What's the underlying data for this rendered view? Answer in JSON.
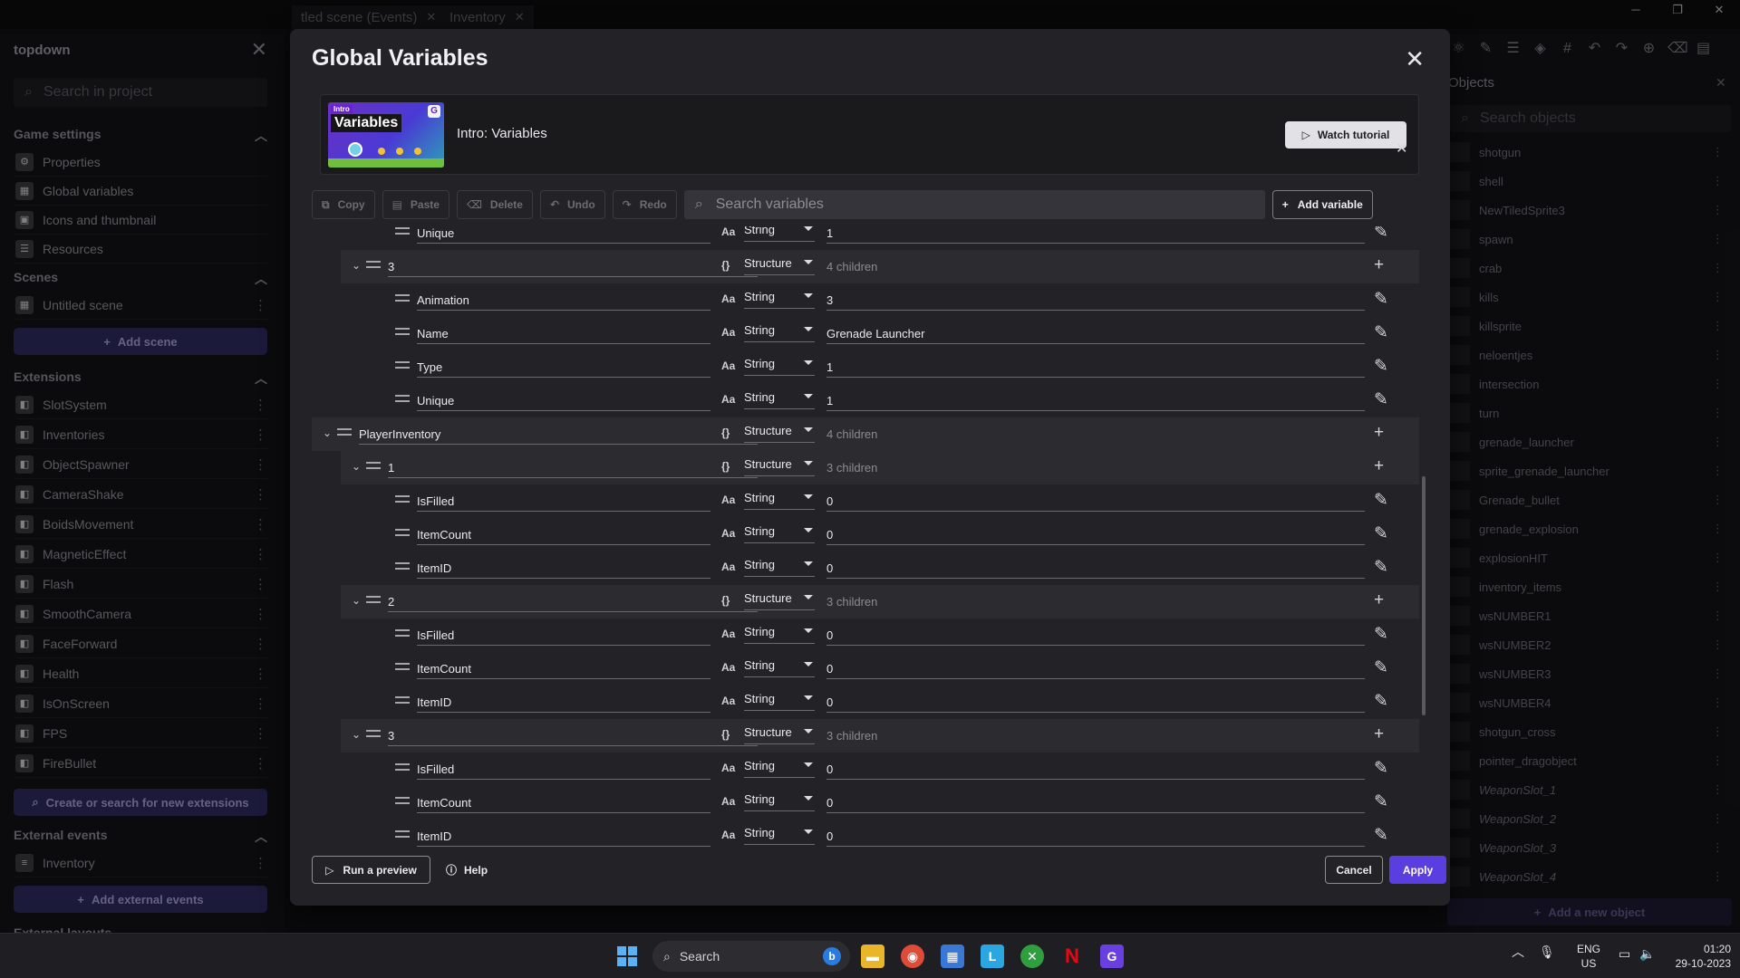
{
  "window": {
    "tabs": [
      {
        "label": "tled scene (Events)"
      },
      {
        "label": "Inventory"
      }
    ],
    "minimize": "─",
    "restore": "❐",
    "close": "✕"
  },
  "sidebar": {
    "project_title": "topdown",
    "search_placeholder": "Search in project",
    "game_settings": {
      "title": "Game settings",
      "items": [
        {
          "label": "Properties",
          "icon": "gear-icon"
        },
        {
          "label": "Global variables",
          "icon": "variables-icon"
        },
        {
          "label": "Icons and thumbnail",
          "icon": "image-icon"
        },
        {
          "label": "Resources",
          "icon": "resources-icon"
        }
      ]
    },
    "scenes": {
      "title": "Scenes",
      "items": [
        {
          "label": "Untitled scene"
        }
      ],
      "add_label": "Add scene"
    },
    "extensions": {
      "title": "Extensions",
      "items": [
        {
          "label": "SlotSystem"
        },
        {
          "label": "Inventories"
        },
        {
          "label": "ObjectSpawner"
        },
        {
          "label": "CameraShake"
        },
        {
          "label": "BoidsMovement"
        },
        {
          "label": "MagneticEffect"
        },
        {
          "label": "Flash"
        },
        {
          "label": "SmoothCamera"
        },
        {
          "label": "FaceForward"
        },
        {
          "label": "Health"
        },
        {
          "label": "IsOnScreen"
        },
        {
          "label": "FPS"
        },
        {
          "label": "FireBullet"
        }
      ],
      "search_label": "Create or search for new extensions"
    },
    "external_events": {
      "title": "External events",
      "items": [
        {
          "label": "Inventory"
        }
      ],
      "add_label": "Add external events"
    },
    "external_layouts_title": "External layouts"
  },
  "objects_panel": {
    "title": "Objects",
    "search_placeholder": "Search objects",
    "items": [
      {
        "name": "shotgun",
        "italic": false
      },
      {
        "name": "shell",
        "italic": false
      },
      {
        "name": "NewTiledSprite3",
        "italic": false
      },
      {
        "name": "spawn",
        "italic": false
      },
      {
        "name": "crab",
        "italic": false
      },
      {
        "name": "kills",
        "italic": false
      },
      {
        "name": "killsprite",
        "italic": false
      },
      {
        "name": "neloentjes",
        "italic": false
      },
      {
        "name": "intersection",
        "italic": false
      },
      {
        "name": "turn",
        "italic": false
      },
      {
        "name": "grenade_launcher",
        "italic": false
      },
      {
        "name": "sprite_grenade_launcher",
        "italic": false
      },
      {
        "name": "Grenade_bullet",
        "italic": false
      },
      {
        "name": "grenade_explosion",
        "italic": false
      },
      {
        "name": "explosionHIT",
        "italic": false
      },
      {
        "name": "inventory_items",
        "italic": false
      },
      {
        "name": "wsNUMBER1",
        "italic": false
      },
      {
        "name": "wsNUMBER2",
        "italic": false
      },
      {
        "name": "wsNUMBER3",
        "italic": false
      },
      {
        "name": "wsNUMBER4",
        "italic": false
      },
      {
        "name": "shotgun_cross",
        "italic": false
      },
      {
        "name": "pointer_dragobject",
        "italic": false
      },
      {
        "name": "WeaponSlot_1",
        "italic": true
      },
      {
        "name": "WeaponSlot_2",
        "italic": true
      },
      {
        "name": "WeaponSlot_3",
        "italic": true
      },
      {
        "name": "WeaponSlot_4",
        "italic": true
      }
    ],
    "add_label": "Add a new object"
  },
  "dialog": {
    "title": "Global Variables",
    "tutorial": {
      "title": "Intro: Variables",
      "thumb_badge": "Intro",
      "thumb_word": "Variables",
      "watch_label": "Watch tutorial"
    },
    "toolbar": {
      "copy": "Copy",
      "paste": "Paste",
      "delete": "Delete",
      "undo": "Undo",
      "redo": "Redo",
      "search_placeholder": "Search variables",
      "add_variable": "Add variable"
    },
    "rows": [
      {
        "depth": 2,
        "kind": "leaf",
        "name": "Unique",
        "type": "String",
        "value": "1"
      },
      {
        "depth": 1,
        "kind": "struct",
        "name": "3",
        "type": "Structure",
        "value": "4 children"
      },
      {
        "depth": 2,
        "kind": "leaf",
        "name": "Animation",
        "type": "String",
        "value": "3"
      },
      {
        "depth": 2,
        "kind": "leaf",
        "name": "Name",
        "type": "String",
        "value": "Grenade Launcher"
      },
      {
        "depth": 2,
        "kind": "leaf",
        "name": "Type",
        "type": "String",
        "value": "1"
      },
      {
        "depth": 2,
        "kind": "leaf",
        "name": "Unique",
        "type": "String",
        "value": "1"
      },
      {
        "depth": 0,
        "kind": "struct",
        "name": "PlayerInventory",
        "type": "Structure",
        "value": "4 children"
      },
      {
        "depth": 1,
        "kind": "struct",
        "name": "1",
        "type": "Structure",
        "value": "3 children"
      },
      {
        "depth": 2,
        "kind": "leaf",
        "name": "IsFilled",
        "type": "String",
        "value": "0"
      },
      {
        "depth": 2,
        "kind": "leaf",
        "name": "ItemCount",
        "type": "String",
        "value": "0"
      },
      {
        "depth": 2,
        "kind": "leaf",
        "name": "ItemID",
        "type": "String",
        "value": "0"
      },
      {
        "depth": 1,
        "kind": "struct",
        "name": "2",
        "type": "Structure",
        "value": "3 children"
      },
      {
        "depth": 2,
        "kind": "leaf",
        "name": "IsFilled",
        "type": "String",
        "value": "0"
      },
      {
        "depth": 2,
        "kind": "leaf",
        "name": "ItemCount",
        "type": "String",
        "value": "0"
      },
      {
        "depth": 2,
        "kind": "leaf",
        "name": "ItemID",
        "type": "String",
        "value": "0"
      },
      {
        "depth": 1,
        "kind": "struct",
        "name": "3",
        "type": "Structure",
        "value": "3 children"
      },
      {
        "depth": 2,
        "kind": "leaf",
        "name": "IsFilled",
        "type": "String",
        "value": "0"
      },
      {
        "depth": 2,
        "kind": "leaf",
        "name": "ItemCount",
        "type": "String",
        "value": "0"
      },
      {
        "depth": 2,
        "kind": "leaf",
        "name": "ItemID",
        "type": "String",
        "value": "0"
      }
    ],
    "footer": {
      "run_preview": "Run a preview",
      "help": "Help",
      "cancel": "Cancel",
      "apply": "Apply"
    }
  },
  "taskbar": {
    "search_label": "Search",
    "lang_top": "ENG",
    "lang_bottom": "US",
    "time": "01:20",
    "date": "29-10-2023"
  },
  "colors": {
    "accent": "#5b3ee0",
    "dialog_bg": "#232327",
    "structure_row_bg": "#2b2b30"
  }
}
